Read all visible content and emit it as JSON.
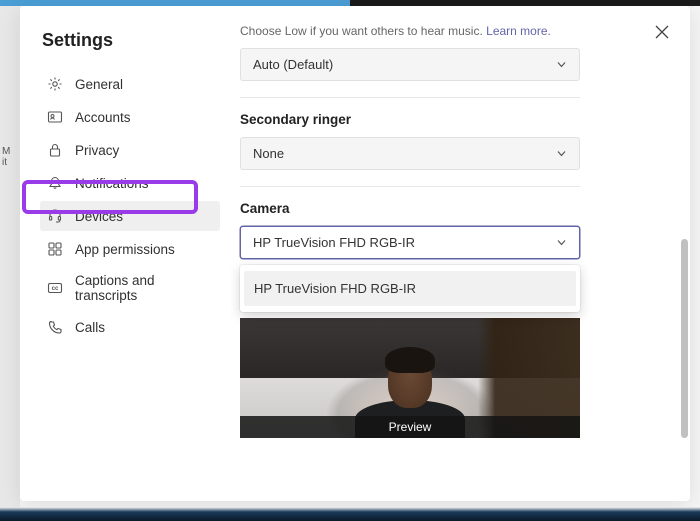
{
  "title": "Settings",
  "sidebar": {
    "items": [
      {
        "label": "General",
        "icon": "gear-icon"
      },
      {
        "label": "Accounts",
        "icon": "person-card-icon"
      },
      {
        "label": "Privacy",
        "icon": "lock-icon"
      },
      {
        "label": "Notifications",
        "icon": "bell-icon"
      },
      {
        "label": "Devices",
        "icon": "headset-icon"
      },
      {
        "label": "App permissions",
        "icon": "grid-icon"
      },
      {
        "label": "Captions and transcripts",
        "icon": "cc-icon"
      },
      {
        "label": "Calls",
        "icon": "phone-icon"
      }
    ]
  },
  "content": {
    "hint": "Choose Low if you want others to hear music.",
    "learn_more": "Learn more.",
    "noise_select": "Auto (Default)",
    "secondary_ringer_label": "Secondary ringer",
    "secondary_ringer_value": "None",
    "camera_label": "Camera",
    "camera_value": "HP TrueVision FHD RGB-IR",
    "camera_options": [
      "HP TrueVision FHD RGB-IR"
    ],
    "preview_label": "Preview"
  }
}
